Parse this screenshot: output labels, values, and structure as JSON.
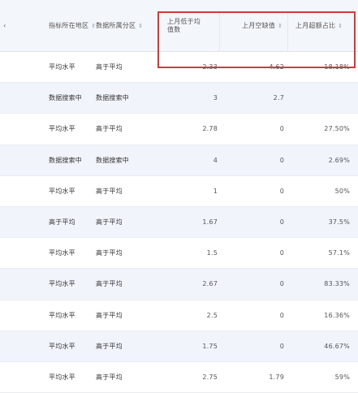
{
  "columns": [
    {
      "label": "指标所在地区"
    },
    {
      "label": "数据所属分区"
    },
    {
      "label": "上月低于均值数"
    },
    {
      "label": "上月空缺值"
    },
    {
      "label": "上月超额占比"
    }
  ],
  "sort_icon": "⇕",
  "edge_icon": "‹",
  "rows": [
    {
      "c1": "平均水平",
      "c2": "高于平均",
      "c3": "2.33",
      "c4": "4.62",
      "c5": "18.18%"
    },
    {
      "c1": "数据搜索中",
      "c2": "数据搜索中",
      "c3": "3",
      "c4": "2.7",
      "c5": ""
    },
    {
      "c1": "平均水平",
      "c2": "高于平均",
      "c3": "2.78",
      "c4": "0",
      "c5": "27.50%"
    },
    {
      "c1": "数据搜索中",
      "c2": "数据搜索中",
      "c3": "4",
      "c4": "0",
      "c5": "2.69%"
    },
    {
      "c1": "平均水平",
      "c2": "高于平均",
      "c3": "1",
      "c4": "0",
      "c5": "50%"
    },
    {
      "c1": "高于平均",
      "c2": "高于平均",
      "c3": "1.67",
      "c4": "0",
      "c5": "37.5%"
    },
    {
      "c1": "平均水平",
      "c2": "高于平均",
      "c3": "1.5",
      "c4": "0",
      "c5": "57.1%"
    },
    {
      "c1": "平均水平",
      "c2": "高于平均",
      "c3": "2.67",
      "c4": "0",
      "c5": "83.33%"
    },
    {
      "c1": "平均水平",
      "c2": "高于平均",
      "c3": "2.5",
      "c4": "0",
      "c5": "16.36%"
    },
    {
      "c1": "平均水平",
      "c2": "高于平均",
      "c3": "1.75",
      "c4": "0",
      "c5": "46.67%"
    },
    {
      "c1": "平均水平",
      "c2": "高于平均",
      "c3": "2.75",
      "c4": "1.79",
      "c5": "59%"
    }
  ]
}
